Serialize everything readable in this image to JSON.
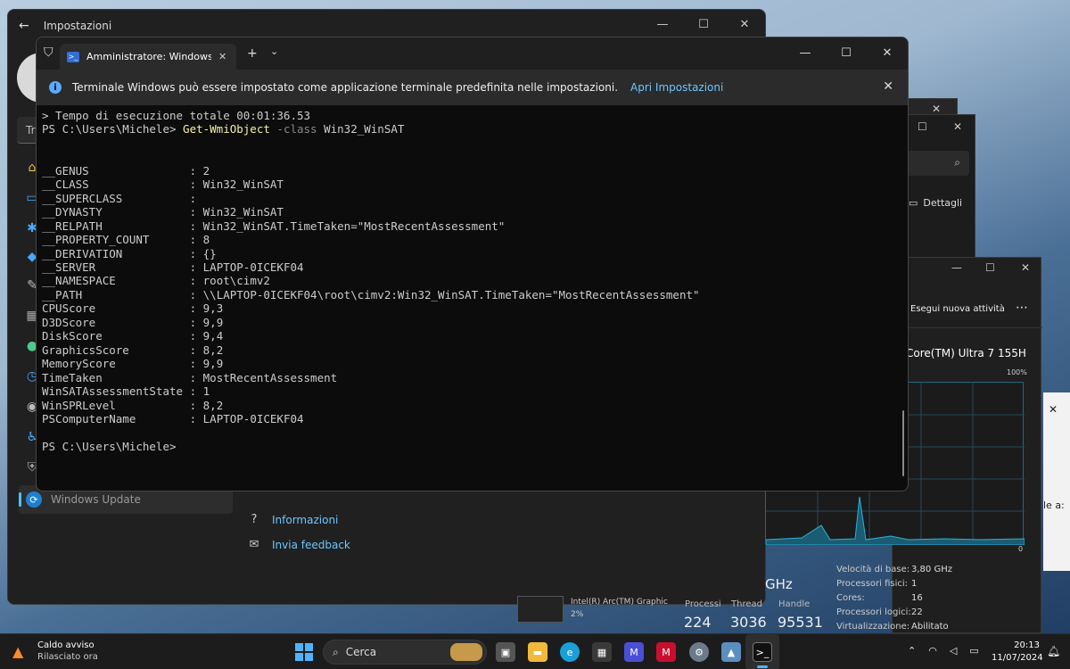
{
  "colors": {
    "terminal_bg": "#0c0c0c",
    "command_yellow": "#f9f1a5",
    "param_gray": "#888888",
    "link_blue": "#6cc6ff",
    "accent_blue": "#4fb3ff"
  },
  "settings": {
    "title": "Impostazioni",
    "search_placeholder": "Tro",
    "active_item": "Windows Update",
    "links": [
      {
        "label": "Informazioni",
        "icon": "help-icon"
      },
      {
        "label": "Invia feedback",
        "icon": "feedback-icon"
      }
    ],
    "sidebar_icons": [
      "home-icon",
      "system-icon",
      "bluetooth-icon",
      "network-icon",
      "personalization-icon",
      "apps-icon",
      "accounts-icon",
      "time-icon",
      "gaming-icon",
      "accessibility-icon",
      "privacy-icon"
    ]
  },
  "explorer": {
    "details_label": "Dettagli"
  },
  "task_manager": {
    "run_task": "Esegui nuova attività",
    "cpu_name": "Core(TM) Ultra 7 155H",
    "percent_label": "100%",
    "zero_label": "0",
    "speed_suffix": "GHz",
    "gpu_label": "Intel(R) Arc(TM) Graphic",
    "gpu_percent": "2%",
    "stats": [
      {
        "label": "Processi",
        "value": "224"
      },
      {
        "label": "Thread",
        "value": "3036"
      },
      {
        "label": "Handle",
        "value": "95531"
      }
    ],
    "specs": [
      {
        "key": "Velocità di base:",
        "value": "3,80 GHz"
      },
      {
        "key": "Processori fisici:",
        "value": "1"
      },
      {
        "key": "Cores:",
        "value": "16"
      },
      {
        "key": "Processori logici:",
        "value": "22"
      },
      {
        "key": "Virtualizzazione:",
        "value": "Abilitato"
      }
    ]
  },
  "desktop": {
    "partial_text": "le a:"
  },
  "terminal": {
    "tab_title": "Amministratore: Windows PowerShell",
    "info_message": "Terminale Windows può essere impostato come applicazione terminale predefinita nelle impostazioni.",
    "info_link": "Apri Impostazioni",
    "line_elapsed": "> Tempo di esecuzione totale 00:01:36.53",
    "prompt": "PS C:\\Users\\Michele> ",
    "command": "Get-WmiObject",
    "param": "-class",
    "arg": " Win32_WinSAT",
    "properties": [
      {
        "name": "__GENUS",
        "value": "2"
      },
      {
        "name": "__CLASS",
        "value": "Win32_WinSAT"
      },
      {
        "name": "__SUPERCLASS",
        "value": ""
      },
      {
        "name": "__DYNASTY",
        "value": "Win32_WinSAT"
      },
      {
        "name": "__RELPATH",
        "value": "Win32_WinSAT.TimeTaken=\"MostRecentAssessment\""
      },
      {
        "name": "__PROPERTY_COUNT",
        "value": "8"
      },
      {
        "name": "__DERIVATION",
        "value": "{}"
      },
      {
        "name": "__SERVER",
        "value": "LAPTOP-0ICEKF04"
      },
      {
        "name": "__NAMESPACE",
        "value": "root\\cimv2"
      },
      {
        "name": "__PATH",
        "value": "\\\\LAPTOP-0ICEKF04\\root\\cimv2:Win32_WinSAT.TimeTaken=\"MostRecentAssessment\""
      },
      {
        "name": "CPUScore",
        "value": "9,3"
      },
      {
        "name": "D3DScore",
        "value": "9,9"
      },
      {
        "name": "DiskScore",
        "value": "9,4"
      },
      {
        "name": "GraphicsScore",
        "value": "8,2"
      },
      {
        "name": "MemoryScore",
        "value": "9,9"
      },
      {
        "name": "TimeTaken",
        "value": "MostRecentAssessment"
      },
      {
        "name": "WinSATAssessmentState",
        "value": "1"
      },
      {
        "name": "WinSPRLevel",
        "value": "8,2"
      },
      {
        "name": "PSComputerName",
        "value": "LAPTOP-0ICEKF04"
      }
    ],
    "final_prompt": "PS C:\\Users\\Michele>"
  },
  "taskbar": {
    "weather_title": "Caldo avviso",
    "weather_sub": "Rilasciato ora",
    "search_label": "Cerca",
    "time": "20:13",
    "date": "11/07/2024",
    "apps": [
      "task-view-icon",
      "file-explorer-icon",
      "edge-icon",
      "store-icon",
      "app-m-icon",
      "mcafee-icon",
      "settings-icon",
      "photos-icon",
      "terminal-icon"
    ]
  }
}
